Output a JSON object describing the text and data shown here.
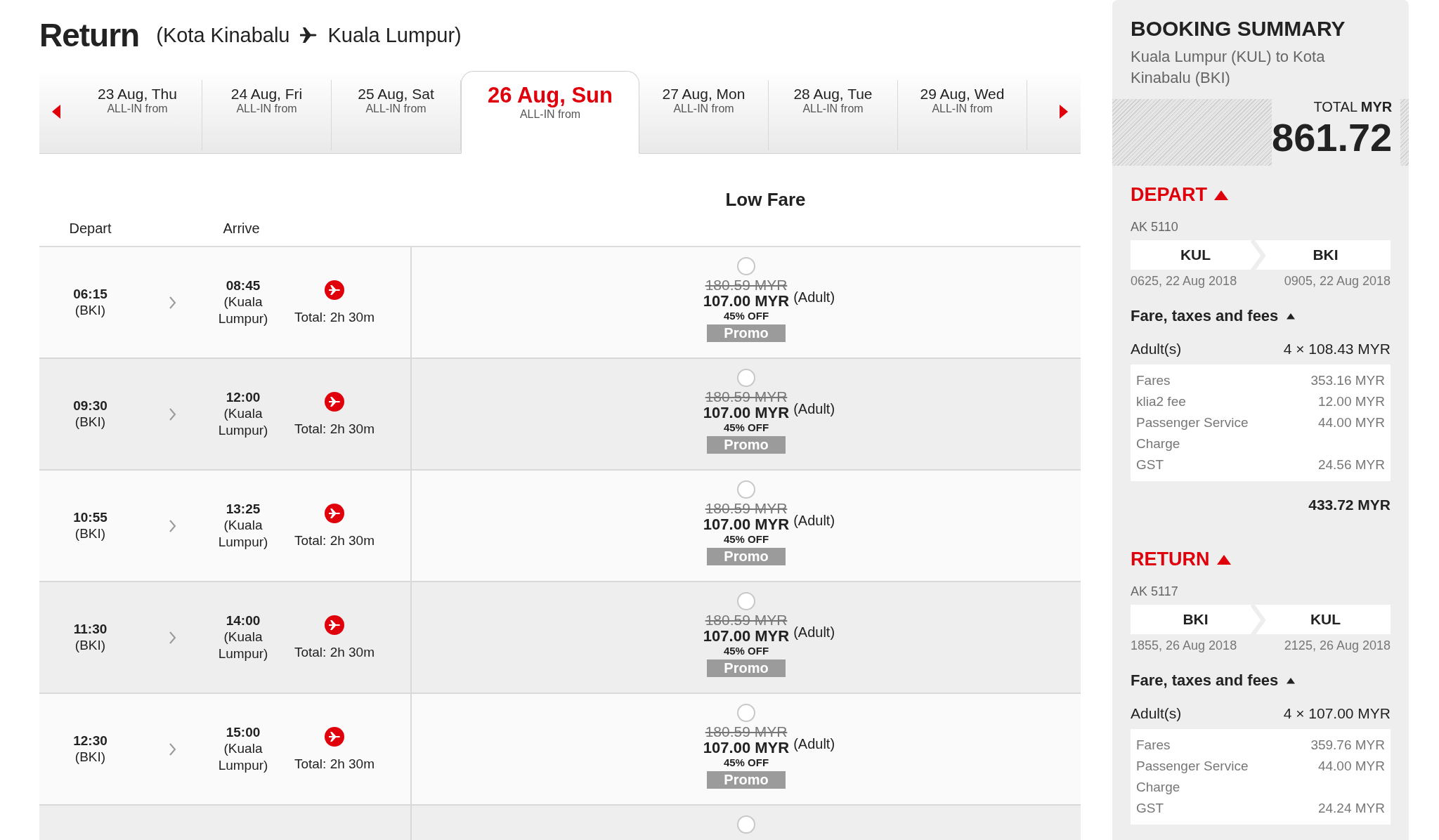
{
  "header": {
    "title": "Return",
    "route_from": "(Kota Kinabalu",
    "route_to": "Kuala Lumpur)"
  },
  "dates": [
    {
      "date": "23 Aug, Thu",
      "note": "ALL-IN from",
      "selected": false
    },
    {
      "date": "24 Aug, Fri",
      "note": "ALL-IN from",
      "selected": false
    },
    {
      "date": "25 Aug, Sat",
      "note": "ALL-IN from",
      "selected": false
    },
    {
      "date": "26 Aug, Sun",
      "note": "ALL-IN from",
      "selected": true
    },
    {
      "date": "27 Aug, Mon",
      "note": "ALL-IN from",
      "selected": false
    },
    {
      "date": "28 Aug, Tue",
      "note": "ALL-IN from",
      "selected": false
    },
    {
      "date": "29 Aug, Wed",
      "note": "ALL-IN from",
      "selected": false
    }
  ],
  "fare_header": "Low Fare",
  "columns": [
    "Depart",
    "Arrive"
  ],
  "flights": [
    {
      "depart_time": "06:15",
      "depart_airport": "(BKI)",
      "arrive_time": "08:45",
      "arrive_airport": "(Kuala Lumpur)",
      "duration": "Total: 2h 30m",
      "old_price": "180.59 MYR",
      "price": "107.00 MYR",
      "passenger": "(Adult)",
      "discount": "45% OFF",
      "badge": "Promo",
      "selected": false
    },
    {
      "depart_time": "09:30",
      "depart_airport": "(BKI)",
      "arrive_time": "12:00",
      "arrive_airport": "(Kuala Lumpur)",
      "duration": "Total: 2h 30m",
      "old_price": "180.59 MYR",
      "price": "107.00 MYR",
      "passenger": "(Adult)",
      "discount": "45% OFF",
      "badge": "Promo",
      "selected": false
    },
    {
      "depart_time": "10:55",
      "depart_airport": "(BKI)",
      "arrive_time": "13:25",
      "arrive_airport": "(Kuala Lumpur)",
      "duration": "Total: 2h 30m",
      "old_price": "180.59 MYR",
      "price": "107.00 MYR",
      "passenger": "(Adult)",
      "discount": "45% OFF",
      "badge": "Promo",
      "selected": false
    },
    {
      "depart_time": "11:30",
      "depart_airport": "(BKI)",
      "arrive_time": "14:00",
      "arrive_airport": "(Kuala Lumpur)",
      "duration": "Total: 2h 30m",
      "old_price": "180.59 MYR",
      "price": "107.00 MYR",
      "passenger": "(Adult)",
      "discount": "45% OFF",
      "badge": "Promo",
      "selected": false
    },
    {
      "depart_time": "12:30",
      "depart_airport": "(BKI)",
      "arrive_time": "15:00",
      "arrive_airport": "(Kuala Lumpur)",
      "duration": "Total: 2h 30m",
      "old_price": "180.59 MYR",
      "price": "107.00 MYR",
      "passenger": "(Adult)",
      "discount": "45% OFF",
      "badge": "Promo",
      "selected": false
    }
  ],
  "next_row": {
    "selected": false
  },
  "summary": {
    "title": "BOOKING SUMMARY",
    "route": "Kuala Lumpur (KUL) to Kota Kinabalu (BKI)",
    "total_label": "TOTAL **MYR**",
    "total": "861.72",
    "sections": [
      {
        "heading": "DEPART",
        "expanded": true,
        "flight_no": "AK 5110",
        "from": "KUL",
        "to": "BKI",
        "from_time": "0625, 22 Aug 2018",
        "to_time": "0905, 22 Aug 2018",
        "fees": {
          "heading": "Fare, taxes and fees",
          "expanded": true,
          "passenger_label": "Adult(s)",
          "passenger_amount": "4 × 108.43 MYR",
          "items": [
            {
              "label": "Fares",
              "amount": "353.16 MYR"
            },
            {
              "label": "klia2 fee",
              "amount": "12.00 MYR"
            },
            {
              "label": "Passenger Service Charge",
              "amount": "44.00 MYR"
            },
            {
              "label": "GST",
              "amount": "24.56 MYR"
            }
          ],
          "subtotal": "433.72 MYR"
        }
      },
      {
        "heading": "RETURN",
        "expanded": true,
        "flight_no": "AK 5117",
        "from": "BKI",
        "to": "KUL",
        "from_time": "1855, 26 Aug 2018",
        "to_time": "2125, 26 Aug 2018",
        "fees": {
          "heading": "Fare, taxes and fees",
          "expanded": true,
          "passenger_label": "Adult(s)",
          "passenger_amount": "4 × 107.00 MYR",
          "items": [
            {
              "label": "Fares",
              "amount": "359.76 MYR"
            },
            {
              "label": "Passenger Service Charge",
              "amount": "44.00 MYR"
            },
            {
              "label": "GST",
              "amount": "24.24 MYR"
            }
          ]
        }
      }
    ]
  }
}
